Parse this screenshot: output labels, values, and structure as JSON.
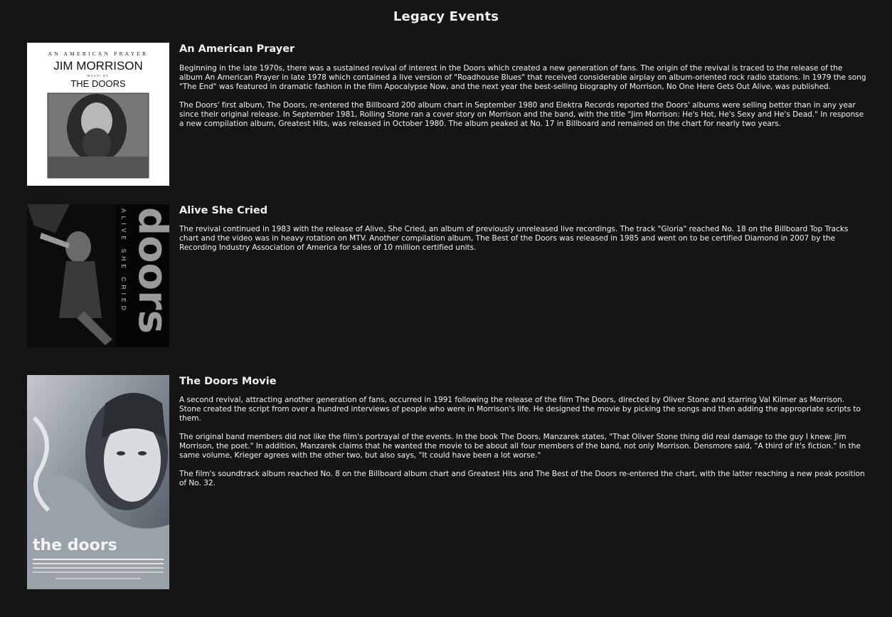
{
  "page": {
    "title": "Legacy Events"
  },
  "events": [
    {
      "title": "An American Prayer",
      "cover": {
        "top_line": "AN AMERICAN PRAYER",
        "artist": "JIM MORRISON",
        "music_by": "MUSIC BY",
        "band": "THE DOORS"
      },
      "paragraphs": [
        "Beginning in the late 1970s, there was a sustained revival of interest in the Doors which created a new generation of fans. The origin of the revival is traced to the release of the album An American Prayer in late 1978 which contained a live version of \"Roadhouse Blues\" that received considerable airplay on album-oriented rock radio stations. In 1979 the song \"The End\" was featured in dramatic fashion in the film Apocalypse Now, and the next year the best-selling biography of Morrison, No One Here Gets Out Alive, was published.",
        "The Doors' first album, The Doors, re-entered the Billboard 200 album chart in September 1980 and Elektra Records reported the Doors' albums were selling better than in any year since their original release. In September 1981, Rolling Stone ran a cover story on Morrison and the band, with the title \"Jim Morrison: He's Hot, He's Sexy and He's Dead.\" In response a new compilation album, Greatest Hits, was released in October 1980. The album peaked at No. 17 in Billboard and remained on the chart for nearly two years."
      ]
    },
    {
      "title": "Alive She Cried",
      "cover": {
        "vertical_text": "ALIVE SHE CRIED",
        "band": "doors"
      },
      "paragraphs": [
        "The revival continued in 1983 with the release of Alive, She Cried, an album of previously unreleased live recordings. The track \"Gloria\" reached No. 18 on the Billboard Top Tracks chart and the video was in heavy rotation on MTV. Another compilation album, The Best of the Doors was released in 1985 and went on to be certified Diamond in 2007 by the Recording Industry Association of America for sales of 10 million certified units."
      ]
    },
    {
      "title": "The Doors Movie",
      "cover": {
        "band": "the doors"
      },
      "paragraphs": [
        "A second revival, attracting another generation of fans, occurred in 1991 following the release of the film The Doors, directed by Oliver Stone and starring Val Kilmer as Morrison. Stone created the script from over a hundred interviews of people who were in Morrison's life. He designed the movie by picking the songs and then adding the appropriate scripts to them.",
        "The original band members did not like the film's portrayal of the events. In the book The Doors, Manzarek states, \"That Oliver Stone thing did real damage to the guy I knew: Jim Morrison, the poet.\" In addition, Manzarek claims that he wanted the movie to be about all four members of the band, not only Morrison. Densmore said, \"A third of it's fiction.\" In the same volume, Krieger agrees with the other two, but also says, \"It could have been a lot worse.\"",
        "The film's soundtrack album reached No. 8 on the Billboard album chart and Greatest Hits and The Best of the Doors re-entered the chart, with the latter reaching a new peak position of No. 32."
      ]
    }
  ]
}
